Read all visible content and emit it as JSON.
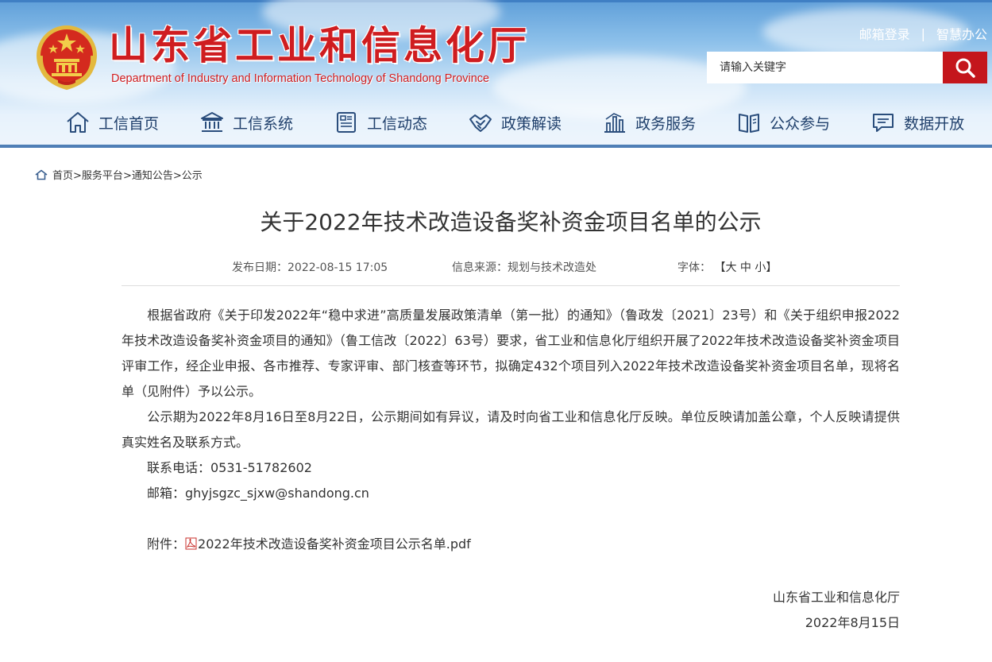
{
  "header": {
    "site_title": "山东省工业和信息化厅",
    "site_subtitle": "Department of Industry and Information Technology of Shandong Province",
    "top_links": {
      "mail_login": "邮箱登录",
      "separator": "|",
      "smart_office": "智慧办公"
    },
    "search": {
      "placeholder": "请输入关键字",
      "button_icon": "search-icon"
    },
    "nav": [
      {
        "label": "工信首页",
        "icon": "home-icon"
      },
      {
        "label": "工信系统",
        "icon": "building-icon"
      },
      {
        "label": "工信动态",
        "icon": "document-icon"
      },
      {
        "label": "政策解读",
        "icon": "handshake-icon"
      },
      {
        "label": "政务服务",
        "icon": "bar-chart-icon"
      },
      {
        "label": "公众参与",
        "icon": "book-icon"
      },
      {
        "label": "数据开放",
        "icon": "chat-icon"
      }
    ],
    "colors": {
      "brand_red": "#cf1d20",
      "nav_text": "#1f3f6b",
      "search_button": "#c4161c"
    }
  },
  "breadcrumb": {
    "icon": "home-icon",
    "items": [
      "首页",
      "服务平台",
      "通知公告",
      "公示"
    ],
    "separator": ">"
  },
  "article": {
    "title": "关于2022年技术改造设备奖补资金项目名单的公示",
    "meta": {
      "date_label": "发布日期：",
      "date": "2022-08-15 17:05",
      "source_label": "信息来源：",
      "source": "规划与技术改造处",
      "font_label": "字体：",
      "font_open": "【",
      "font_large": "大",
      "font_medium": "中",
      "font_small": "小",
      "font_close": "】"
    },
    "paragraph1": "根据省政府《关于印发2022年“稳中求进”高质量发展政策清单（第一批）的通知》（鲁政发〔2021〕23号）和《关于组织申报2022年技术改造设备奖补资金项目的通知》（鲁工信改〔2022〕63号）要求，省工业和信息化厅组织开展了2022年技术改造设备奖补资金项目评审工作，经企业申报、各市推荐、专家评审、部门核查等环节，拟确定432个项目列入2022年技术改造设备奖补资金项目名单，现将名单（见附件）予以公示。",
    "paragraph2": "公示期为2022年8月16日至8月22日，公示期间如有异议，请及时向省工业和信息化厅反映。单位反映请加盖公章，个人反映请提供真实姓名及联系方式。",
    "contact_phone": "联系电话：0531-51782602",
    "contact_email": "邮箱：ghyjsgzc_sjxw@shandong.cn",
    "attachment_label": "附件：",
    "attachment_icon": "pdf-icon",
    "attachment_file": "2022年技术改造设备奖补资金项目公示名单.pdf",
    "signature_org": "山东省工业和信息化厅",
    "signature_date": "2022年8月15日"
  }
}
